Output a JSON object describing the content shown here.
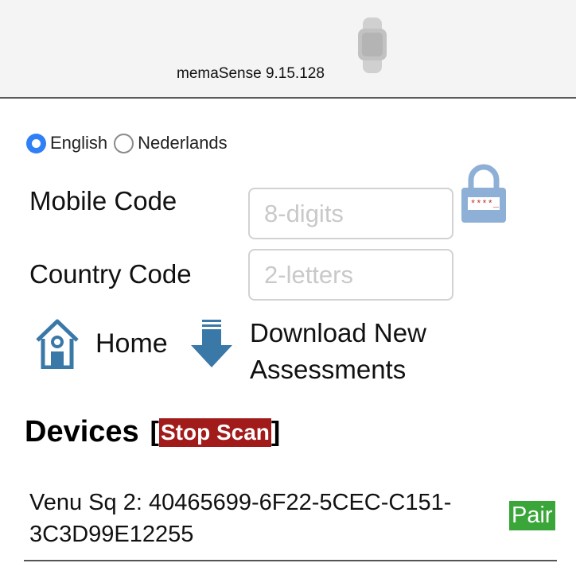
{
  "header": {
    "version_text": "memaSense 9.15.128",
    "icon": "fitness-band-icon"
  },
  "language": {
    "options": [
      {
        "label": "English",
        "selected": true
      },
      {
        "label": "Nederlands",
        "selected": false
      }
    ]
  },
  "form": {
    "mobile_code": {
      "label": "Mobile Code",
      "value": "",
      "placeholder": "8-digits"
    },
    "country_code": {
      "label": "Country Code",
      "value": "",
      "placeholder": "2-letters"
    },
    "lock_icon": "password-lock-icon",
    "lock_mask_text": "****_"
  },
  "actions": {
    "home_label": "Home",
    "home_icon": "home-icon",
    "download_label": "Download New Assessments",
    "download_icon": "download-arrow-icon"
  },
  "devices": {
    "title": "Devices",
    "bracket_open": "[",
    "bracket_close": "]",
    "stop_scan_label": "Stop Scan",
    "items": [
      {
        "name": "Venu Sq 2: 40465699-6F22-5CEC-C151-3C3D99E12255",
        "action_label": "Pair"
      }
    ]
  },
  "colors": {
    "accent_blue": "#2f7ff6",
    "icon_blue": "#3a78a8",
    "stop_red": "#a11b1b",
    "pair_green": "#3aa63a",
    "lock_blue": "#8fb0d6"
  }
}
